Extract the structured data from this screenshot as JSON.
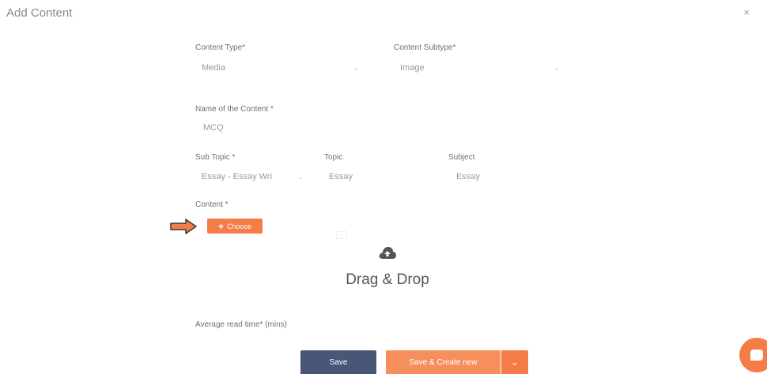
{
  "dialog": {
    "title": "Add Content",
    "close_glyph": "×"
  },
  "form": {
    "content_type": {
      "label": "Content Type*",
      "value": "Media"
    },
    "content_subtype": {
      "label": "Content Subtype*",
      "value": "Image"
    },
    "content_name": {
      "label": "Name of the Content *",
      "value": "MCQ"
    },
    "sub_topic": {
      "label": "Sub Topic *",
      "value": "Essay - Essay Wri"
    },
    "topic": {
      "label": "Topic",
      "value": "Essay"
    },
    "subject": {
      "label": "Subject",
      "value": "Essay"
    },
    "content": {
      "label": "Content *",
      "choose_label": "Choose"
    },
    "average_read_time": {
      "label": "Average read time* (mins)"
    }
  },
  "dropzone": {
    "title": "Drag & Drop",
    "icon": "cloud-upload-icon"
  },
  "footer": {
    "save_label": "Save",
    "save_new_label": "Save & Create new"
  },
  "colors": {
    "accent": "#f47c46",
    "save_button": "#4a5677",
    "save_new_button": "#f78f5d"
  }
}
